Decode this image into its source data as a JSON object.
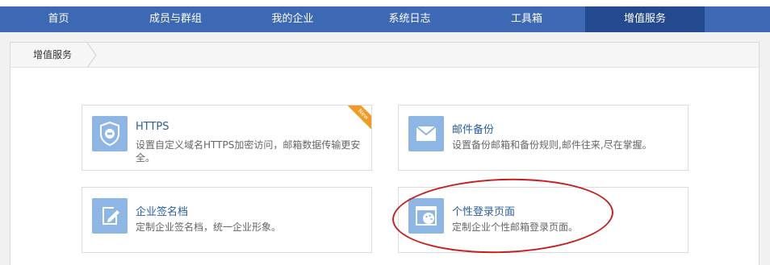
{
  "nav": {
    "items": [
      "首页",
      "成员与群组",
      "我的企业",
      "系统日志",
      "工具箱",
      "增值服务"
    ],
    "active_index": 5
  },
  "breadcrumb": {
    "label": "增值服务"
  },
  "cards": [
    {
      "title": "HTTPS",
      "desc": "设置自定义域名HTTPS加密访问，邮箱数据传输更安全。",
      "icon": "shield-icon",
      "badge": "New"
    },
    {
      "title": "邮件备份",
      "desc": "设置备份邮箱和备份规则,邮件往来,尽在掌握。",
      "icon": "mail-icon"
    },
    {
      "title": "企业签名档",
      "desc": "定制企业签名档，统一企业形象。",
      "icon": "edit-signature-icon"
    },
    {
      "title": "个性登录页面",
      "desc": "定制企业个性邮箱登录页面。",
      "icon": "palette-icon"
    }
  ],
  "colors": {
    "nav_bg": "#3d69b4",
    "nav_active": "#23498e",
    "icon_tile": "#8eb6e5",
    "badge": "#f29a24",
    "highlight_ring": "#c81d1d"
  }
}
